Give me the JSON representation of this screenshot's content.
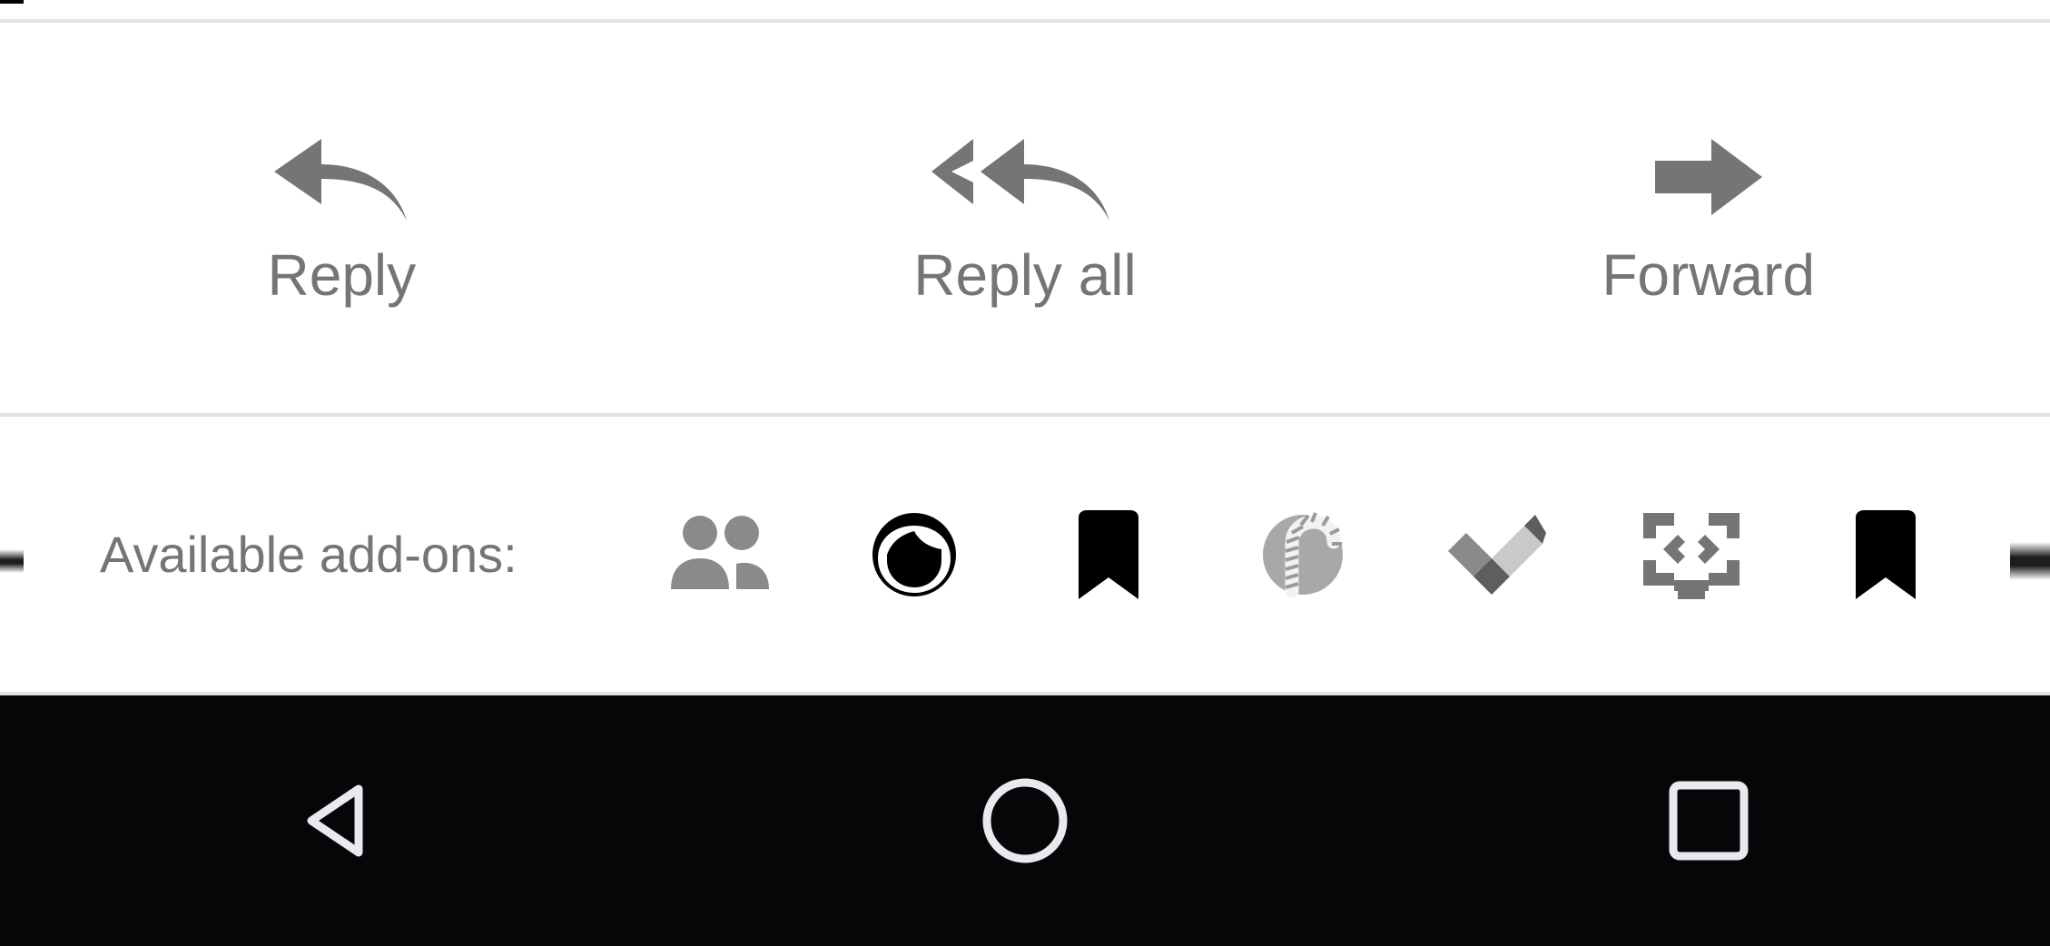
{
  "screen": {
    "app_context": "email-message-actions",
    "background_color": "#ffffff",
    "divider_color": "#e2e3e4",
    "muted_text_color": "#757575",
    "nav_bar_color": "#040607"
  },
  "action_bar": {
    "items": [
      {
        "label": "Reply",
        "icon": "reply-arrow-icon",
        "icon_color": "#757575"
      },
      {
        "label": "Reply all",
        "icon": "reply-all-arrow-icon",
        "icon_color": "#757575"
      },
      {
        "label": "Forward",
        "icon": "forward-arrow-icon",
        "icon_color": "#757575"
      }
    ]
  },
  "addons_bar": {
    "label": "Available add-ons:",
    "icons": [
      {
        "name": "people-icon",
        "color": "#8a8a8a"
      },
      {
        "name": "face-avatar-icon",
        "color": "#000000"
      },
      {
        "name": "bookmark-icon",
        "color": "#000000"
      },
      {
        "name": "candy-cane-circle-icon",
        "color": "#a8a8a8"
      },
      {
        "name": "tasks-check-icon",
        "color": "#6e6e6e"
      },
      {
        "name": "code-screen-icon",
        "color": "#757575"
      },
      {
        "name": "bookmark-icon-2",
        "color": "#000000"
      }
    ],
    "clipped_left_icon": "partial-icon-clipped-left",
    "clipped_right_icon": "partial-icon-clipped-right"
  },
  "nav_bar": {
    "buttons": [
      {
        "name": "back-button",
        "icon": "back-triangle-icon",
        "color": "#e8eaed"
      },
      {
        "name": "home-button",
        "icon": "home-circle-icon",
        "color": "#e8eaed"
      },
      {
        "name": "recents-button",
        "icon": "recents-square-icon",
        "color": "#e8eaed"
      }
    ]
  }
}
